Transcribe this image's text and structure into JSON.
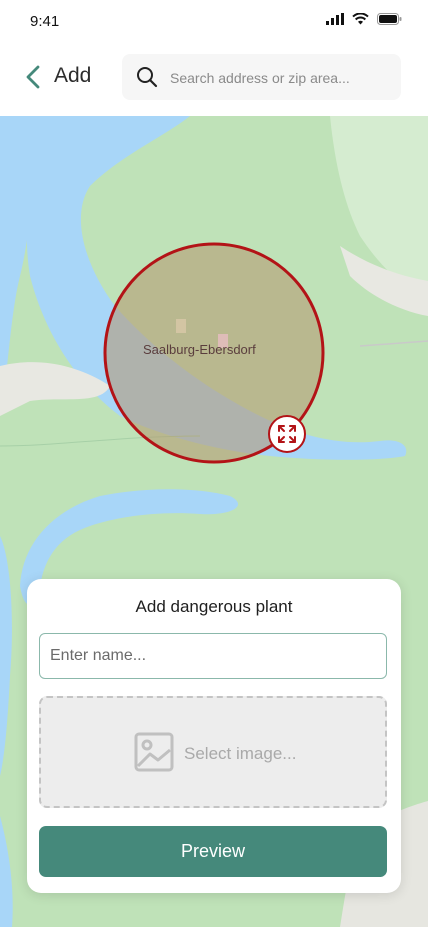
{
  "status_bar": {
    "time": "9:41"
  },
  "header": {
    "back_icon": "chevron-left-icon",
    "title": "Add",
    "search": {
      "icon": "search-icon",
      "placeholder": "Search address or zip area..."
    }
  },
  "map": {
    "place_label": "Saalburg-Ebersdorf",
    "radius_color": "#b31317",
    "resize_icon": "expand-arrows-icon"
  },
  "card": {
    "title": "Add dangerous plant",
    "name_placeholder": "Enter name...",
    "image_label": "Select image...",
    "image_icon": "image-icon",
    "preview_label": "Preview"
  },
  "colors": {
    "accent": "#45897b",
    "map_water": "#a8d6f8",
    "map_land": "#bfe2b8",
    "danger": "#b31317"
  }
}
